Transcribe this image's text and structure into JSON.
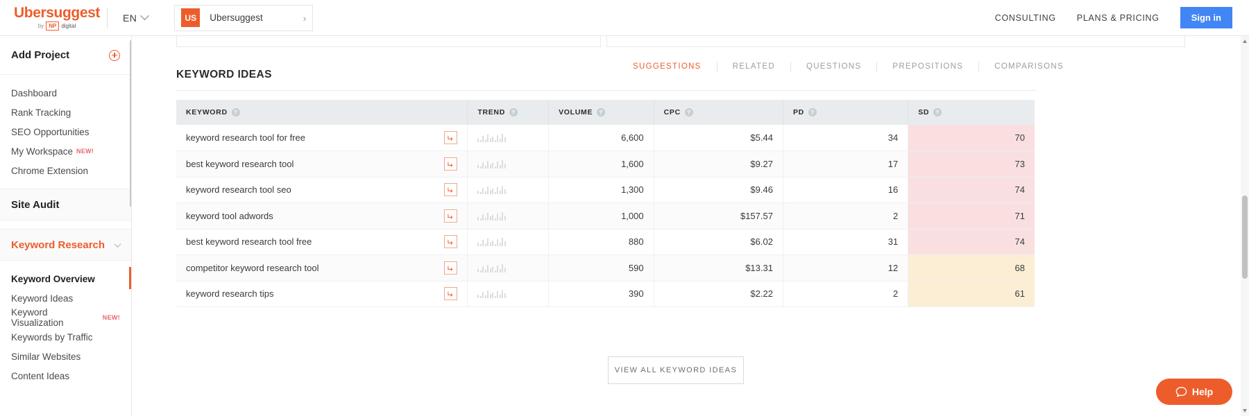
{
  "topbar": {
    "logo_word": "Ubersuggest",
    "logo_by": "by",
    "logo_np": "NP",
    "logo_digital": "digital",
    "language": "EN",
    "project_flag": "US",
    "project_name": "Ubersuggest",
    "project_arrow": "›",
    "nav": [
      {
        "label": "CONSULTING"
      },
      {
        "label": "PLANS & PRICING"
      }
    ],
    "signin_label": "Sign in",
    "signin_color": "#4285f4",
    "brand_color": "#ed5d2b"
  },
  "sidebar": {
    "add_project_label": "Add Project",
    "items": [
      {
        "label": "Dashboard",
        "badge": ""
      },
      {
        "label": "Rank Tracking",
        "badge": ""
      },
      {
        "label": "SEO Opportunities",
        "badge": ""
      },
      {
        "label": "My Workspace",
        "badge": "NEW!"
      },
      {
        "label": "Chrome Extension",
        "badge": ""
      }
    ],
    "site_audit_label": "Site Audit",
    "keyword_research_label": "Keyword Research",
    "keyword_items": [
      {
        "label": "Keyword Overview",
        "badge": "",
        "active": true
      },
      {
        "label": "Keyword Ideas",
        "badge": "",
        "active": false
      },
      {
        "label": "Keyword Visualization",
        "badge": "NEW!",
        "active": false
      },
      {
        "label": "Keywords by Traffic",
        "badge": "",
        "active": false
      },
      {
        "label": "Similar Websites",
        "badge": "",
        "active": false
      },
      {
        "label": "Content Ideas",
        "badge": "",
        "active": false
      }
    ]
  },
  "main": {
    "section_title": "KEYWORD IDEAS",
    "tabs": [
      {
        "label": "SUGGESTIONS",
        "active": true
      },
      {
        "label": "RELATED",
        "active": false
      },
      {
        "label": "QUESTIONS",
        "active": false
      },
      {
        "label": "PREPOSITIONS",
        "active": false
      },
      {
        "label": "COMPARISONS",
        "active": false
      }
    ],
    "view_all_label": "VIEW ALL KEYWORD IDEAS",
    "table": {
      "columns": [
        {
          "label": "KEYWORD",
          "help": "?"
        },
        {
          "label": "TREND",
          "help": "?"
        },
        {
          "label": "VOLUME",
          "help": "?"
        },
        {
          "label": "CPC",
          "help": "?"
        },
        {
          "label": "PD",
          "help": "?"
        },
        {
          "label": "SD",
          "help": "?"
        }
      ],
      "rows": [
        {
          "keyword": "keyword research tool for free",
          "volume": "6,600",
          "cpc": "$5.44",
          "pd": "34",
          "sd": "70",
          "sd_color": "#fadfe0"
        },
        {
          "keyword": "best keyword research tool",
          "volume": "1,600",
          "cpc": "$9.27",
          "pd": "17",
          "sd": "73",
          "sd_color": "#fadfe0"
        },
        {
          "keyword": "keyword research tool seo",
          "volume": "1,300",
          "cpc": "$9.46",
          "pd": "16",
          "sd": "74",
          "sd_color": "#fadfe0"
        },
        {
          "keyword": "keyword tool adwords",
          "volume": "1,000",
          "cpc": "$157.57",
          "pd": "2",
          "sd": "71",
          "sd_color": "#fadfe0"
        },
        {
          "keyword": "best keyword research tool free",
          "volume": "880",
          "cpc": "$6.02",
          "pd": "31",
          "sd": "74",
          "sd_color": "#fadfe0"
        },
        {
          "keyword": "competitor keyword research tool",
          "volume": "590",
          "cpc": "$13.31",
          "pd": "12",
          "sd": "68",
          "sd_color": "#fbeed4"
        },
        {
          "keyword": "keyword research tips",
          "volume": "390",
          "cpc": "$2.22",
          "pd": "2",
          "sd": "61",
          "sd_color": "#fbeed4"
        }
      ]
    }
  },
  "help_widget": {
    "label": "Help",
    "color": "#ed5d2b"
  }
}
